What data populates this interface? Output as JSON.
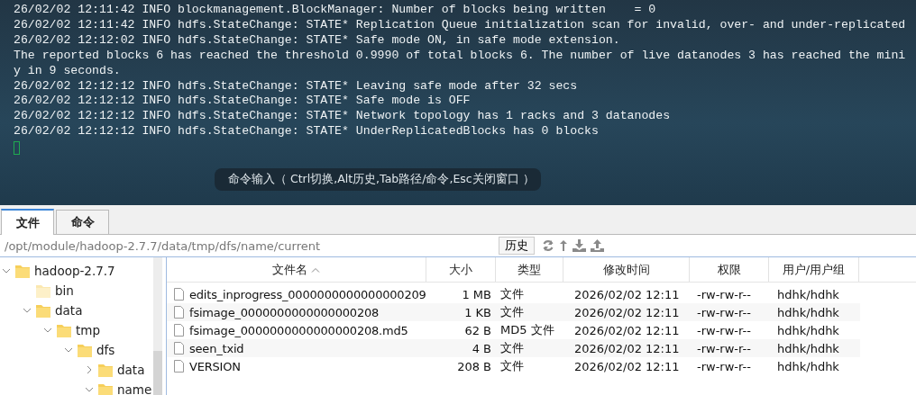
{
  "terminal": {
    "lines": [
      "26/02/02 12:11:42 INFO blockmanagement.BlockManager: Number of blocks being written    = 0",
      "26/02/02 12:11:42 INFO hdfs.StateChange: STATE* Replication Queue initialization scan for invalid, over- and under-replicated",
      "26/02/02 12:12:02 INFO hdfs.StateChange: STATE* Safe mode ON, in safe mode extension.",
      "The reported blocks 6 has reached the threshold 0.9990 of total blocks 6. The number of live datanodes 3 has reached the mini",
      "y in 9 seconds.",
      "26/02/02 12:12:12 INFO hdfs.StateChange: STATE* Leaving safe mode after 32 secs",
      "26/02/02 12:12:12 INFO hdfs.StateChange: STATE* Safe mode is OFF",
      "26/02/02 12:12:12 INFO hdfs.StateChange: STATE* Network topology has 1 racks and 3 datanodes",
      "26/02/02 12:12:12 INFO hdfs.StateChange: STATE* UnderReplicatedBlocks has 0 blocks"
    ],
    "command_hint": "命令输入（ Ctrl切换,Alt历史,Tab路径/命令,Esc关闭窗口 ）"
  },
  "tabs": [
    {
      "label": "文件",
      "selected": true
    },
    {
      "label": "命令",
      "selected": false
    }
  ],
  "path_bar": {
    "path": "/opt/module/hadoop-2.7.7/data/tmp/dfs/name/current",
    "history_button": "历史"
  },
  "tree": [
    {
      "label": "hadoop-2.7.7",
      "expanded": true,
      "children": [
        {
          "label": "bin"
        },
        {
          "label": "data",
          "expanded": true,
          "children": [
            {
              "label": "tmp",
              "expanded": true,
              "children": [
                {
                  "label": "dfs",
                  "expanded": true,
                  "children": [
                    {
                      "label": "data",
                      "expanded": false
                    },
                    {
                      "label": "name",
                      "expanded": true
                    }
                  ]
                }
              ]
            }
          ]
        }
      ]
    }
  ],
  "table": {
    "columns": [
      "文件名",
      "大小",
      "类型",
      "修改时间",
      "权限",
      "用户/用户组"
    ],
    "rows": [
      {
        "name": "edits_inprogress_0000000000000000209",
        "size": "1 MB",
        "type": "文件",
        "modified": "2026/02/02 12:11",
        "permissions": "-rw-rw-r--",
        "owner": "hdhk/hdhk"
      },
      {
        "name": "fsimage_0000000000000000208",
        "size": "1 KB",
        "type": "文件",
        "modified": "2026/02/02 12:11",
        "permissions": "-rw-rw-r--",
        "owner": "hdhk/hdhk"
      },
      {
        "name": "fsimage_0000000000000000208.md5",
        "size": "62 B",
        "type": "MD5 文件",
        "modified": "2026/02/02 12:11",
        "permissions": "-rw-rw-r--",
        "owner": "hdhk/hdhk"
      },
      {
        "name": "seen_txid",
        "size": "4 B",
        "type": "文件",
        "modified": "2026/02/02 12:11",
        "permissions": "-rw-rw-r--",
        "owner": "hdhk/hdhk"
      },
      {
        "name": "VERSION",
        "size": "208 B",
        "type": "文件",
        "modified": "2026/02/02 12:11",
        "permissions": "-rw-rw-r--",
        "owner": "hdhk/hdhk"
      }
    ]
  }
}
